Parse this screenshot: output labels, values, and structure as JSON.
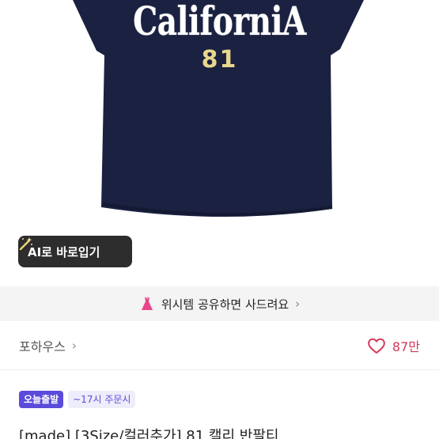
{
  "colors": {
    "shirt": "#1b2140",
    "accent_purple": "#5b4bdb",
    "heart": "#d43a5a",
    "banner_bg": "#f4f4f4",
    "ai_button_bg": "#2d2d2d"
  },
  "product_image": {
    "print_title": "CaliforniA",
    "print_number": "81"
  },
  "ai_button": {
    "icon": "magic-wand-icon",
    "label": "AI로 바로입기"
  },
  "promo_banner": {
    "icon": "dress-icon",
    "text": "위시템 공유하면 사드려요",
    "chevron": "›"
  },
  "seller": {
    "name": "포하우스",
    "chevron": "›",
    "likes_icon": "heart-outline-icon",
    "likes_count": "87만"
  },
  "badges": {
    "today": "오늘출발",
    "cutoff": "~17시 주문시"
  },
  "product": {
    "title": "[made] [3Size/컬러추가] 81 캘리 반팔티"
  }
}
